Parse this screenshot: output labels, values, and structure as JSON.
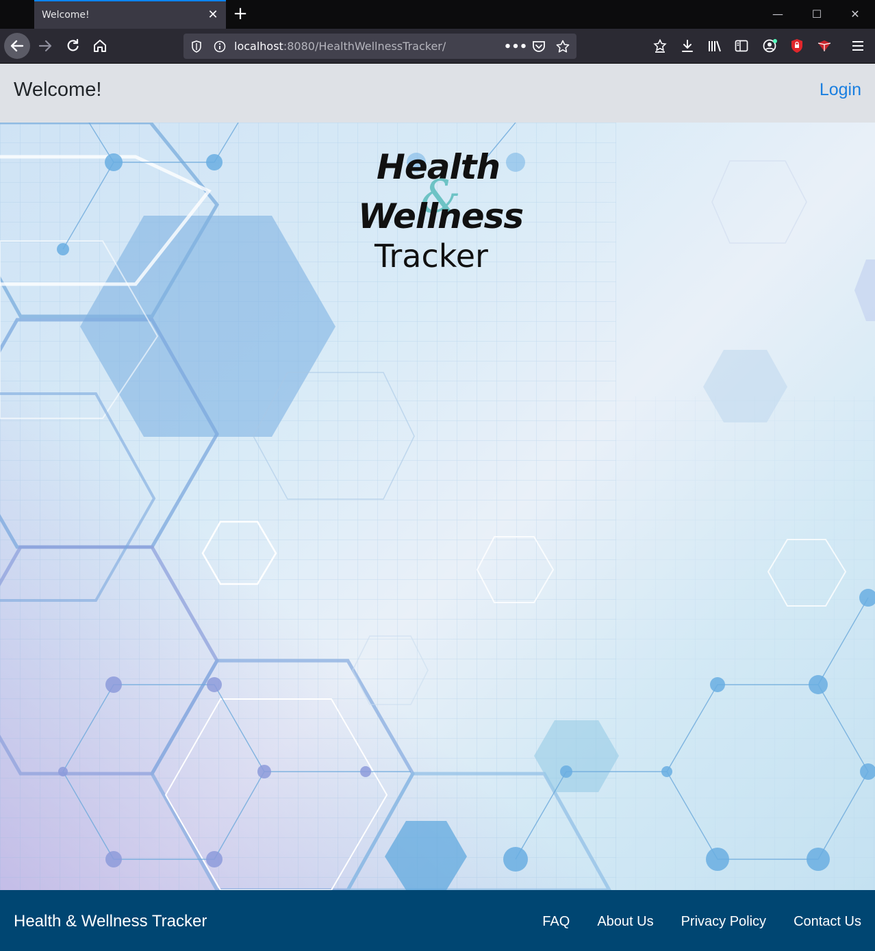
{
  "browser": {
    "tab_title": "Welcome!",
    "url_host": "localhost",
    "url_path": ":8080/HealthWellnessTracker/",
    "toolbar_icons": [
      "back-arrow-icon",
      "forward-arrow-icon",
      "reload-icon",
      "home-icon",
      "shield-icon",
      "info-icon",
      "more-dots-icon",
      "pocket-icon",
      "bookmark-star-icon",
      "reading-list-icon",
      "download-icon",
      "library-icon",
      "sidebar-icon",
      "account-icon",
      "extension-shield-icon",
      "extension-gem-icon",
      "menu-icon"
    ]
  },
  "header": {
    "title": "Welcome!",
    "login_label": "Login"
  },
  "logo": {
    "line1": "Health",
    "amp": "&",
    "line2": "Wellness",
    "line3": "Tracker"
  },
  "footer": {
    "brand": "Health & Wellness Tracker",
    "links": [
      "FAQ",
      "About Us",
      "Privacy Policy",
      "Contact Us"
    ]
  },
  "colors": {
    "accent_link": "#1a7fe0",
    "footer_bg": "#004672",
    "header_bg": "#dee1e6",
    "logo_amp": "#5bbdbd"
  }
}
